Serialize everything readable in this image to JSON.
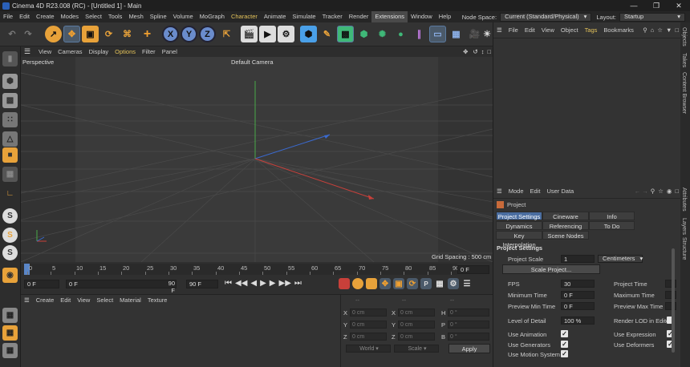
{
  "window": {
    "title": "Cinema 4D R23.008 (RC) - [Untitled 1] - Main",
    "controls": [
      "—",
      "❐",
      "✕"
    ]
  },
  "menubar": {
    "items": [
      "File",
      "Edit",
      "Create",
      "Modes",
      "Select",
      "Tools",
      "Mesh",
      "Spline",
      "Volume",
      "MoGraph",
      "Character",
      "Animate",
      "Simulate",
      "Tracker",
      "Render",
      "Extensions",
      "Window",
      "Help"
    ],
    "node_space_label": "Node Space:",
    "node_space_value": "Current (Standard/Physical)",
    "layout_label": "Layout:",
    "layout_value": "Startup"
  },
  "toolbar": {
    "axis_buttons": [
      "X",
      "Y",
      "Z"
    ]
  },
  "viewport": {
    "menu": [
      "View",
      "Cameras",
      "Display",
      "Options",
      "Filter",
      "Panel"
    ],
    "active_menu": "Options",
    "view_name": "Perspective",
    "camera": "Default Camera",
    "grid_spacing": "Grid Spacing : 500 cm",
    "nav_icons": [
      "move-view-icon",
      "rotate-view-icon",
      "zoom-view-icon",
      "toggle-views-icon"
    ]
  },
  "timeline": {
    "ticks": [
      "0",
      "5",
      "10",
      "15",
      "20",
      "25",
      "30",
      "35",
      "40",
      "45",
      "50",
      "55",
      "60",
      "65",
      "70",
      "75",
      "80",
      "85",
      "90"
    ],
    "current_frame_marker": "0",
    "end_frame_field": "0 F",
    "start_field": "0 F",
    "min_field": "0 F",
    "max_field": "90 F",
    "end_field": "90 F"
  },
  "object_manager": {
    "menu": [
      "File",
      "Edit",
      "View",
      "Object",
      "Tags",
      "Bookmarks"
    ],
    "active_menu": "Tags"
  },
  "side_tabs_top": [
    "Objects",
    "Takes",
    "Content Browser"
  ],
  "side_tabs_bottom": [
    "Attributes",
    "Layers",
    "Structure"
  ],
  "attributes": {
    "menu": [
      "Mode",
      "Edit",
      "User Data"
    ],
    "object_name": "Project",
    "tabs_row1": [
      "Project Settings",
      "Cineware",
      "Info"
    ],
    "tabs_row2": [
      "Dynamics",
      "Referencing",
      "To Do"
    ],
    "tabs_row3": [
      "Key Interpolation",
      "Scene Nodes"
    ],
    "active_tab": "Project Settings",
    "section_title": "Project Settings",
    "project_scale_label": "Project Scale",
    "project_scale_value": "1",
    "project_scale_unit": "Centimeters",
    "scale_button": "Scale Project...",
    "fps_label": "FPS",
    "fps_value": "30",
    "project_time_label": "Project Time",
    "min_time_label": "Minimum Time",
    "min_time_value": "0 F",
    "max_time_label": "Maximum Time",
    "preview_min_label": "Preview Min Time",
    "preview_min_value": "0 F",
    "preview_max_label": "Preview Max Time",
    "lod_label": "Level of Detail",
    "lod_value": "100 %",
    "render_lod_label": "Render LOD in Editor",
    "use_animation_label": "Use Animation",
    "use_expression_label": "Use Expression",
    "use_generators_label": "Use Generators",
    "use_deformers_label": "Use Deformers",
    "use_motion_label": "Use Motion System"
  },
  "material_manager": {
    "menu": [
      "Create",
      "Edit",
      "View",
      "Select",
      "Material",
      "Texture"
    ]
  },
  "coordinates": {
    "col1_labels": [
      "X",
      "Y",
      "Z"
    ],
    "col2_labels": [
      "X",
      "Y",
      "Z"
    ],
    "col3_labels": [
      "H",
      "P",
      "B"
    ],
    "pos_values": [
      "0 cm",
      "0 cm",
      "0 cm"
    ],
    "size_values": [
      "0 cm",
      "0 cm",
      "0 cm"
    ],
    "rot_values": [
      "0 °",
      "0 °",
      "0 °"
    ],
    "header_dashes": [
      "--",
      "--",
      "--"
    ],
    "world_dropdown": "World",
    "scale_dropdown": "Scale",
    "apply_button": "Apply"
  },
  "colors": {
    "accent_blue": "#4a6da0",
    "axis_x": "#c8403a",
    "axis_y": "#48a848",
    "axis_z": "#3a6ad0",
    "active_yellow": "#e3c25a"
  }
}
